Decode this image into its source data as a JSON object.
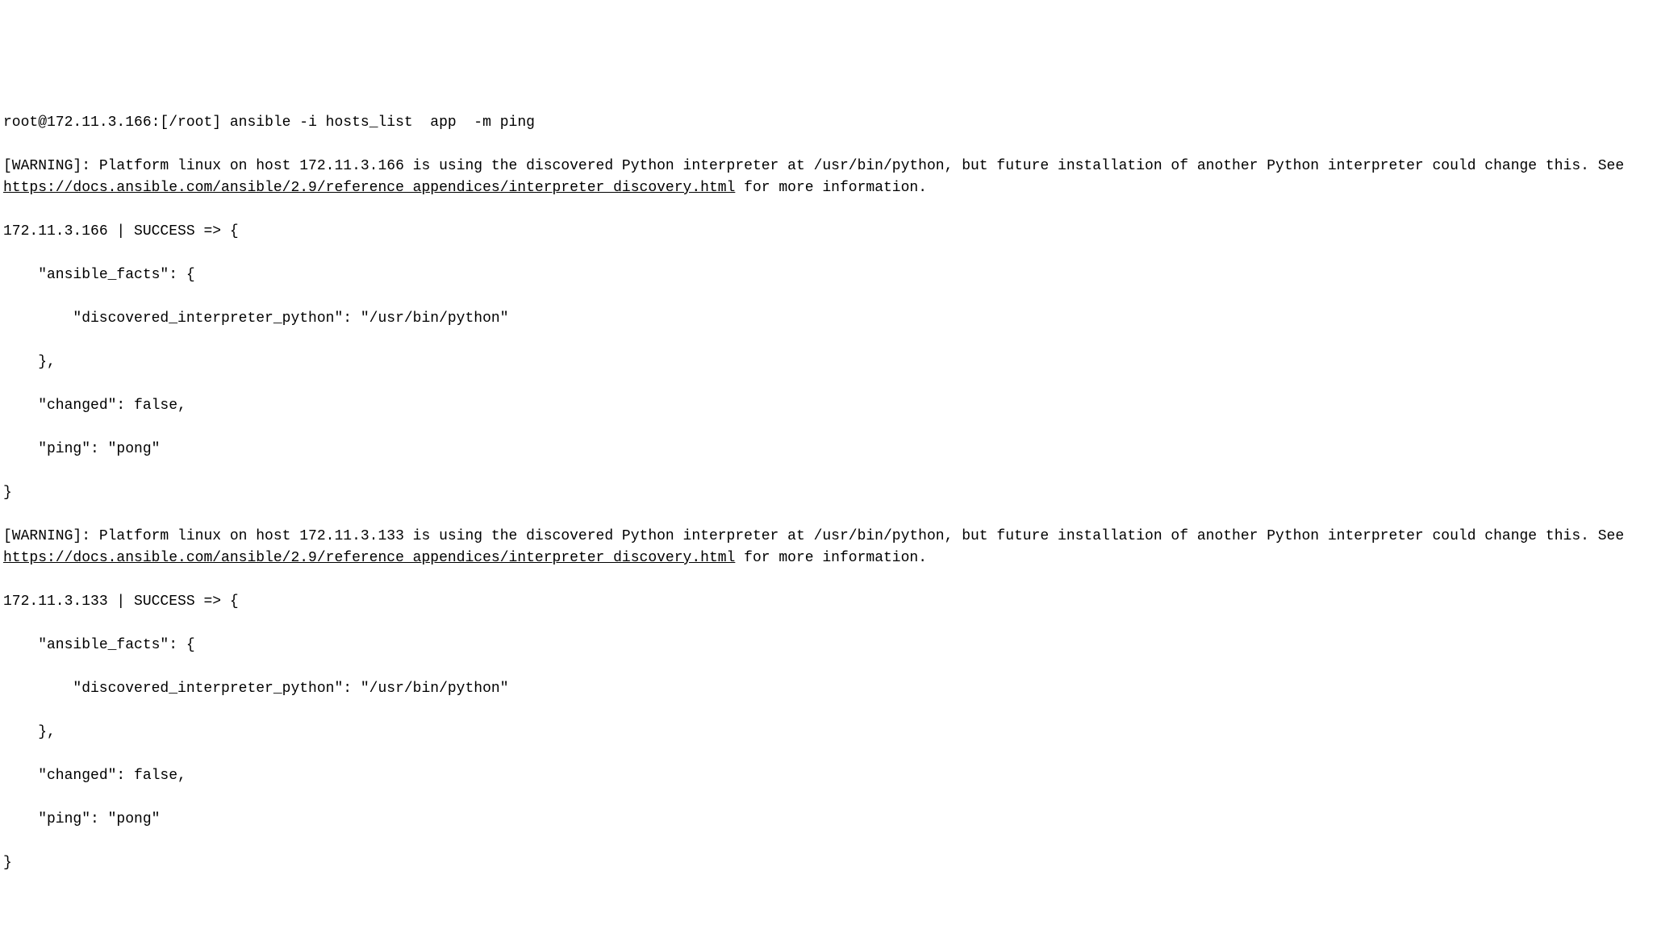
{
  "prompt": {
    "user_host": "root@172.11.3.166:[/root]",
    "command": "ansible -i hosts_list  app  -m ping"
  },
  "warning1": {
    "prefix": "[WARNING]: Platform linux on host 172.11.3.166 is using the discovered Python interpreter at /usr/bin/python, but future installation of another Python interpreter could change this. See ",
    "link": "https://docs.ansible.com/ansible/2.9/reference_appendices/interpreter_discovery.html",
    "suffix": " for more information."
  },
  "result1": {
    "header": "172.11.3.166 | SUCCESS => {",
    "facts_open": "\"ansible_facts\": {",
    "interpreter": "\"discovered_interpreter_python\": \"/usr/bin/python\"",
    "facts_close": "},",
    "changed": "\"changed\": false,",
    "ping": "\"ping\": \"pong\"",
    "close": "}"
  },
  "warning2": {
    "prefix": "[WARNING]: Platform linux on host 172.11.3.133 is using the discovered Python interpreter at /usr/bin/python, but future installation of another Python interpreter could change this. See ",
    "link": "https://docs.ansible.com/ansible/2.9/reference_appendices/interpreter_discovery.html",
    "suffix": " for more information."
  },
  "result2": {
    "header": "172.11.3.133 | SUCCESS => {",
    "facts_open": "\"ansible_facts\": {",
    "interpreter": "\"discovered_interpreter_python\": \"/usr/bin/python\"",
    "facts_close": "},",
    "changed": "\"changed\": false,",
    "ping": "\"ping\": \"pong\"",
    "close": "}"
  }
}
